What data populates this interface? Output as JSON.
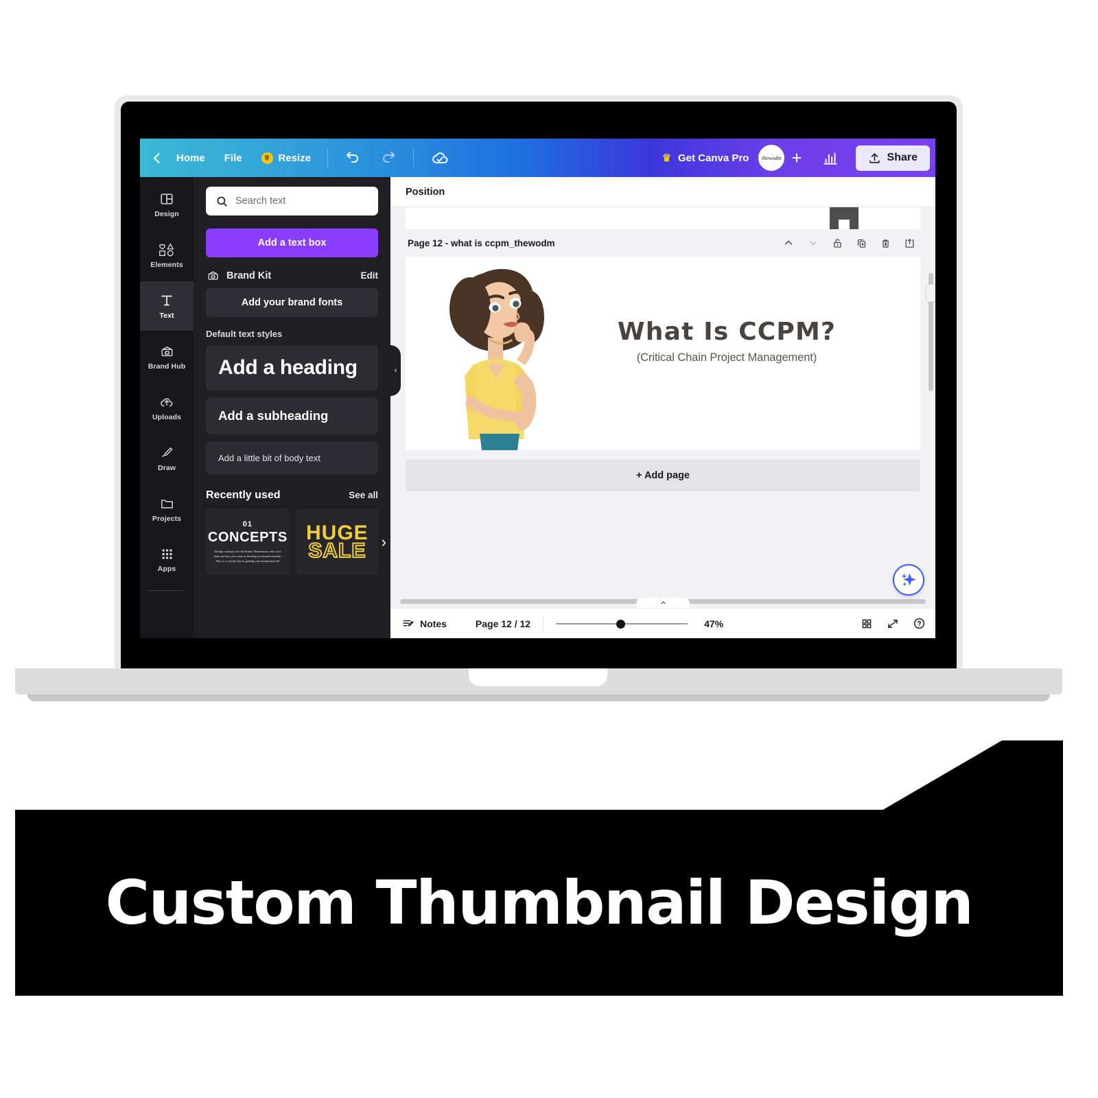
{
  "app": {
    "topbar": {
      "back_icon": "chevron-left-icon",
      "home_label": "Home",
      "file_label": "File",
      "resize_label": "Resize",
      "resize_badge_icon": "crown-icon",
      "undo_icon": "undo-icon",
      "redo_icon": "redo-icon",
      "cloud_saved_icon": "cloud-saved-icon",
      "pro_label": "Get Canva Pro",
      "pro_icon": "crown-icon",
      "avatar_label": "thewodm",
      "add_member_label": "+",
      "insights_icon": "bar-chart-icon",
      "share_label": "Share",
      "share_icon": "upload-icon"
    },
    "rail": {
      "items": [
        {
          "label": "Design",
          "icon": "layout-icon",
          "active": false
        },
        {
          "label": "Elements",
          "icon": "shapes-icon",
          "active": false
        },
        {
          "label": "Text",
          "icon": "text-t-icon",
          "active": true
        },
        {
          "label": "Brand Hub",
          "icon": "wallet-icon",
          "active": false
        },
        {
          "label": "Uploads",
          "icon": "upload-cloud-icon",
          "active": false
        },
        {
          "label": "Draw",
          "icon": "pencil-icon",
          "active": false
        },
        {
          "label": "Projects",
          "icon": "folder-icon",
          "active": false
        },
        {
          "label": "Apps",
          "icon": "grid-dots-icon",
          "active": false
        }
      ]
    },
    "panel": {
      "search_placeholder": "Search text",
      "search_value": "",
      "search_icon": "search-icon",
      "add_text_box_label": "Add a text box",
      "brand_kit_label": "Brand Kit",
      "brand_kit_icon": "wallet-icon",
      "brand_kit_edit_label": "Edit",
      "add_brand_fonts_label": "Add your brand fonts",
      "default_styles_label": "Default text styles",
      "styles": [
        {
          "label": "Add a heading"
        },
        {
          "label": "Add a subheading"
        },
        {
          "label": "Add a little bit of body text"
        }
      ],
      "recently_used_label": "Recently used",
      "see_all_label": "See all",
      "recent_items": [
        {
          "number": "01",
          "title": "CONCEPTS",
          "body": "Design concepts for the brand. Brainstorm with your team on how you want to develop you brand visually. This is a crucial step in getting your brand noticed!"
        },
        {
          "line1": "HUGE",
          "line2": "SALE"
        }
      ],
      "next_icon": "chevron-right-icon",
      "collapse_icon": "chevron-left-icon"
    },
    "editor": {
      "position_label": "Position",
      "page_title": "Page 12 - what is ccpm_thewodm",
      "page_actions": [
        {
          "name": "move-up-icon"
        },
        {
          "name": "move-down-icon"
        },
        {
          "name": "lock-icon"
        },
        {
          "name": "duplicate-icon"
        },
        {
          "name": "delete-icon"
        },
        {
          "name": "export-page-icon"
        }
      ],
      "slide": {
        "title": "What Is CCPM?",
        "subtitle": "(Critical Chain Project Management)"
      },
      "add_page_label": "+ Add page",
      "magic_icon": "magic-sparkle-icon",
      "tray_icon": "chevron-up-icon"
    },
    "bottombar": {
      "notes_label": "Notes",
      "notes_icon": "notes-icon",
      "page_count_label": "Page 12 / 12",
      "zoom_label": "47%",
      "grid_icon": "grid-view-icon",
      "fullscreen_icon": "expand-icon",
      "help_icon": "help-circle-icon"
    }
  },
  "banner": {
    "caption": "Custom Thumbnail Design"
  },
  "colors": {
    "canva_purple": "#8b3dff",
    "topbar_start": "#3cb9d6",
    "topbar_end": "#7b3ff0",
    "panel_bg": "#1f1f24",
    "rail_bg": "#18181c",
    "banner_bg": "#000000",
    "shirt_yellow": "#f5da6a",
    "hair_brown": "#4a3425"
  }
}
